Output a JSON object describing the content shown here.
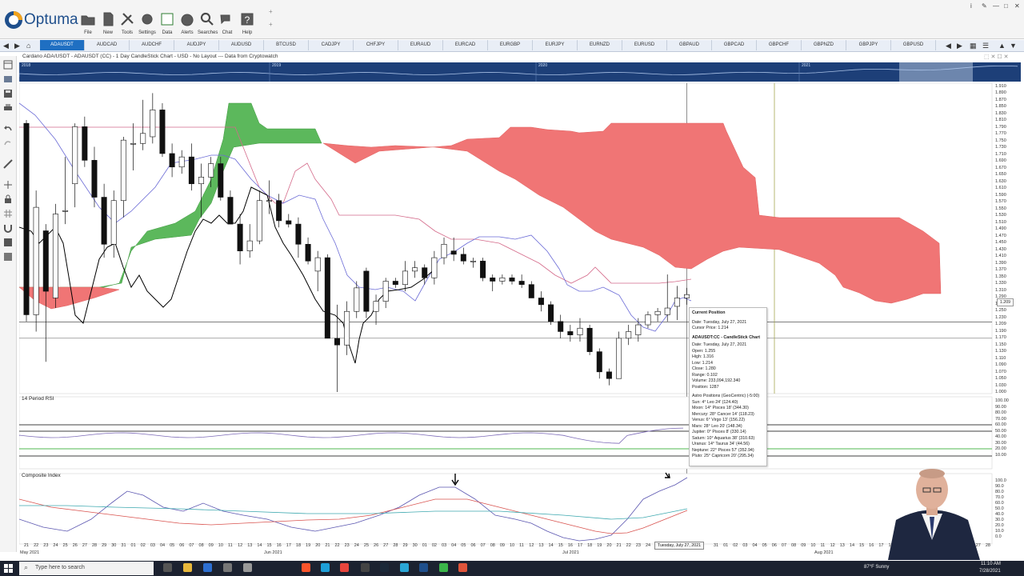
{
  "app": {
    "name": "Optuma",
    "toolbar": [
      {
        "label": "File",
        "icon": "folder-icon"
      },
      {
        "label": "New",
        "icon": "new-page-icon"
      },
      {
        "label": "Tools",
        "icon": "tools-icon"
      },
      {
        "label": "Settings",
        "icon": "gear-icon"
      },
      {
        "label": "Data",
        "icon": "binary-data-icon"
      },
      {
        "label": "Alerts",
        "icon": "alarm-clock-icon"
      },
      {
        "label": "Searches",
        "icon": "magnifier-icon"
      },
      {
        "label": "Chat",
        "icon": "chat-bubbles-icon"
      },
      {
        "label": "Help",
        "icon": "question-mark-icon"
      }
    ],
    "window_controls": {
      "info": "i",
      "pin": "✎",
      "minimize": "—",
      "maximize": "□",
      "close": "✕"
    }
  },
  "symbol_tabs": [
    "ADAUSDT",
    "AUDCAD",
    "AUDCHF",
    "AUDJPY",
    "AUDUSD",
    "BTCUSD",
    "CADJPY",
    "CHFJPY",
    "EURAUD",
    "EURCAD",
    "EURGBP",
    "EURJPY",
    "EURNZD",
    "EURUSD",
    "GBPAUD",
    "GBPCAD",
    "GBPCHF",
    "GBPNZD",
    "GBPJPY",
    "GBPUSD"
  ],
  "active_tab": "ADAUSDT",
  "chart_title": "Cardano ADA/USDT - ADAUSDT (CC) - 1 Day CandleStick Chart - USD - No Layout --- Data from Cryptowatch",
  "overview_years": [
    "2018",
    "2019",
    "2020",
    "2021"
  ],
  "panels": {
    "rsi_title": "14 Period RSI",
    "composite_title": "Composite Index"
  },
  "price_axis": [
    "1.910",
    "1.890",
    "1.870",
    "1.850",
    "1.830",
    "1.810",
    "1.790",
    "1.770",
    "1.750",
    "1.730",
    "1.710",
    "1.690",
    "1.670",
    "1.650",
    "1.630",
    "1.610",
    "1.590",
    "1.570",
    "1.550",
    "1.530",
    "1.510",
    "1.490",
    "1.470",
    "1.450",
    "1.430",
    "1.410",
    "1.390",
    "1.370",
    "1.350",
    "1.330",
    "1.310",
    "1.290",
    "1.270",
    "1.250",
    "1.230",
    "1.209",
    "1.190",
    "1.170",
    "1.150",
    "1.130",
    "1.110",
    "1.090",
    "1.070",
    "1.050",
    "1.030",
    "1.000"
  ],
  "rsi_axis": [
    "100.00",
    "90.00",
    "80.00",
    "70.00",
    "60.00",
    "50.00",
    "40.00",
    "30.00",
    "20.00",
    "10.00"
  ],
  "composite_axis": [
    "100.0",
    "90.0",
    "80.0",
    "70.0",
    "60.0",
    "50.0",
    "40.0",
    "30.0",
    "20.0",
    "10.0",
    "0.0"
  ],
  "date_axis": [
    "21",
    "22",
    "23",
    "24",
    "25",
    "26",
    "27",
    "28",
    "29",
    "30",
    "31",
    "01",
    "02",
    "03",
    "04",
    "05",
    "06",
    "07",
    "08",
    "09",
    "10",
    "11",
    "12",
    "13",
    "14",
    "15",
    "16",
    "17",
    "18",
    "19",
    "20",
    "21",
    "22",
    "23",
    "24",
    "25",
    "26",
    "27",
    "28",
    "29",
    "30",
    "01",
    "02",
    "03",
    "04",
    "05",
    "06",
    "07",
    "08",
    "09",
    "10",
    "11",
    "12",
    "13",
    "14",
    "15",
    "16",
    "17",
    "18",
    "19",
    "20",
    "21",
    "22",
    "23",
    "24",
    "25",
    "26",
    "27",
    "28",
    "29",
    "30",
    "31",
    "01",
    "02",
    "03",
    "04",
    "05",
    "06",
    "07",
    "08",
    "09",
    "10",
    "11",
    "12",
    "13",
    "14",
    "15",
    "16",
    "17",
    "18",
    "19",
    "20",
    "21",
    "22",
    "23",
    "24",
    "25",
    "26",
    "27",
    "28",
    "29",
    "30",
    "31",
    "01",
    "02",
    "03",
    "04",
    "05",
    "06",
    "07",
    "08",
    "09"
  ],
  "month_labels": [
    "May 2021",
    "Jun 2021",
    "Jul 2021",
    "Aug 2021"
  ],
  "cursor_date": "Tuesday, July 27, 2021",
  "price_tag": "1.209",
  "popup": {
    "section1_title": "Current Position",
    "section1": [
      "Date: Tuesday, July 27, 2021",
      "Cursor Price: 1.214"
    ],
    "section2_title": "ADAUSDT:CC - CandleStick Chart",
    "section2": [
      "Date: Tuesday, July 27, 2021",
      "Open: 1.255",
      "High: 1.316",
      "Low: 1.214",
      "Close: 1.280",
      "Range: 0.102",
      "Volume: 233,094,192.340",
      "Position: 1287"
    ],
    "section3_title": "Astro Positions (GeoCentric) (-5:00)",
    "section3": [
      "Sun: 4° Leo 24' (124.40)",
      "Moon: 14° Pisces 18' (344.30)",
      "Mercury: 28° Cancer 14' (118.23)",
      "Venus: 6° Virgo 13' (156.22)",
      "Mars: 28° Leo 20' (148.34)",
      "Jupiter: 0° Pisces 8' (330.14)",
      "Saturn: 10° Aquarius 38' (310.63)",
      "Uranus: 14° Taurus 34' (44.56)",
      "Neptune: 22° Pisces 57' (352.94)",
      "Pluto: 25° Capricorn 20' (295.34)"
    ]
  },
  "taskbar": {
    "search_placeholder": "Type here to search",
    "weather": "87°F Sunny",
    "time": "11:10 AM",
    "date": "7/28/2021"
  },
  "colors": {
    "kumo_bull": "#5cb85c",
    "kumo_bear": "#f07575",
    "tenkan": "#6b6bd6",
    "kijun": "#d46a8a",
    "chikou": "#000000",
    "accent": "#1f6fc2"
  },
  "chart_data": {
    "type": "candlestick",
    "instrument": "ADAUSDT",
    "timeframe": "1 Day",
    "ylim": [
      1.0,
      1.91
    ],
    "candles": [
      {
        "x": "May 21",
        "o": 1.8,
        "h": 1.81,
        "l": 1.21,
        "c": 1.23
      },
      {
        "x": "May 22",
        "o": 1.23,
        "h": 1.6,
        "l": 1.18,
        "c": 1.55
      },
      {
        "x": "May 23",
        "o": 1.48,
        "h": 1.5,
        "l": 1.09,
        "c": 1.3
      },
      {
        "x": "May 24",
        "o": 1.28,
        "h": 1.56,
        "l": 1.25,
        "c": 1.53
      },
      {
        "x": "May 25",
        "o": 1.54,
        "h": 1.7,
        "l": 1.5,
        "c": 1.54
      },
      {
        "x": "May 26",
        "o": 1.62,
        "h": 1.8,
        "l": 1.55,
        "c": 1.79
      },
      {
        "x": "May 27",
        "o": 1.79,
        "h": 1.82,
        "l": 1.67,
        "c": 1.69
      },
      {
        "x": "May 28",
        "o": 1.69,
        "h": 1.73,
        "l": 1.55,
        "c": 1.58
      },
      {
        "x": "May 29",
        "o": 1.58,
        "h": 1.62,
        "l": 1.4,
        "c": 1.44
      },
      {
        "x": "May 30",
        "o": 1.44,
        "h": 1.6,
        "l": 1.4,
        "c": 1.57
      },
      {
        "x": "May 31",
        "o": 1.57,
        "h": 1.76,
        "l": 1.52,
        "c": 1.75
      },
      {
        "x": "Jun 01",
        "o": 1.74,
        "h": 1.8,
        "l": 1.66,
        "c": 1.74
      },
      {
        "x": "Jun 02",
        "o": 1.74,
        "h": 1.87,
        "l": 1.72,
        "c": 1.77
      },
      {
        "x": "Jun 03",
        "o": 1.76,
        "h": 1.89,
        "l": 1.74,
        "c": 1.84
      },
      {
        "x": "Jun 04",
        "o": 1.84,
        "h": 1.86,
        "l": 1.7,
        "c": 1.71
      },
      {
        "x": "Jun 05",
        "o": 1.71,
        "h": 1.74,
        "l": 1.64,
        "c": 1.67
      },
      {
        "x": "Jun 06",
        "o": 1.67,
        "h": 1.72,
        "l": 1.65,
        "c": 1.7
      },
      {
        "x": "Jun 07",
        "o": 1.7,
        "h": 1.74,
        "l": 1.6,
        "c": 1.62
      },
      {
        "x": "Jun 08",
        "o": 1.62,
        "h": 1.68,
        "l": 1.52,
        "c": 1.64
      },
      {
        "x": "Jun 09",
        "o": 1.64,
        "h": 1.7,
        "l": 1.61,
        "c": 1.68
      },
      {
        "x": "Jun 10",
        "o": 1.68,
        "h": 1.7,
        "l": 1.57,
        "c": 1.58
      },
      {
        "x": "Jun 11",
        "o": 1.58,
        "h": 1.6,
        "l": 1.5,
        "c": 1.5
      },
      {
        "x": "Jun 12",
        "o": 1.5,
        "h": 1.53,
        "l": 1.38,
        "c": 1.42
      },
      {
        "x": "Jun 13",
        "o": 1.42,
        "h": 1.5,
        "l": 1.4,
        "c": 1.45
      },
      {
        "x": "Jun 14",
        "o": 1.45,
        "h": 1.6,
        "l": 1.44,
        "c": 1.57
      },
      {
        "x": "Jun 15",
        "o": 1.57,
        "h": 1.63,
        "l": 1.53,
        "c": 1.57
      },
      {
        "x": "Jun 16",
        "o": 1.57,
        "h": 1.59,
        "l": 1.49,
        "c": 1.51
      },
      {
        "x": "Jun 17",
        "o": 1.51,
        "h": 1.53,
        "l": 1.49,
        "c": 1.5
      },
      {
        "x": "Jun 18",
        "o": 1.5,
        "h": 1.52,
        "l": 1.4,
        "c": 1.44
      },
      {
        "x": "Jun 19",
        "o": 1.44,
        "h": 1.46,
        "l": 1.38,
        "c": 1.39
      },
      {
        "x": "Jun 20",
        "o": 1.36,
        "h": 1.42,
        "l": 1.3,
        "c": 1.4
      },
      {
        "x": "Jun 21",
        "o": 1.4,
        "h": 1.41,
        "l": 1.16,
        "c": 1.16
      },
      {
        "x": "Jun 22",
        "o": 1.16,
        "h": 1.26,
        "l": 1.0,
        "c": 1.14
      },
      {
        "x": "Jun 23",
        "o": 1.14,
        "h": 1.27,
        "l": 1.11,
        "c": 1.24
      },
      {
        "x": "Jun 24",
        "o": 1.24,
        "h": 1.33,
        "l": 1.22,
        "c": 1.31
      },
      {
        "x": "Jun 25",
        "o": 1.36,
        "h": 1.37,
        "l": 1.22,
        "c": 1.24
      },
      {
        "x": "Jun 26",
        "o": 1.24,
        "h": 1.29,
        "l": 1.2,
        "c": 1.27
      },
      {
        "x": "Jun 27",
        "o": 1.27,
        "h": 1.34,
        "l": 1.25,
        "c": 1.33
      },
      {
        "x": "Jun 28",
        "o": 1.33,
        "h": 1.34,
        "l": 1.31,
        "c": 1.32
      },
      {
        "x": "Jun 29",
        "o": 1.32,
        "h": 1.39,
        "l": 1.3,
        "c": 1.36
      },
      {
        "x": "Jun 30",
        "o": 1.36,
        "h": 1.39,
        "l": 1.34,
        "c": 1.37
      },
      {
        "x": "Jul 01",
        "o": 1.37,
        "h": 1.38,
        "l": 1.32,
        "c": 1.34
      },
      {
        "x": "Jul 02",
        "o": 1.34,
        "h": 1.42,
        "l": 1.32,
        "c": 1.4
      },
      {
        "x": "Jul 03",
        "o": 1.4,
        "h": 1.46,
        "l": 1.38,
        "c": 1.44
      },
      {
        "x": "Jul 04",
        "o": 1.42,
        "h": 1.46,
        "l": 1.39,
        "c": 1.41
      },
      {
        "x": "Jul 05",
        "o": 1.41,
        "h": 1.43,
        "l": 1.38,
        "c": 1.39
      },
      {
        "x": "Jul 06",
        "o": 1.39,
        "h": 1.4,
        "l": 1.37,
        "c": 1.39
      },
      {
        "x": "Jul 07",
        "o": 1.39,
        "h": 1.4,
        "l": 1.33,
        "c": 1.34
      },
      {
        "x": "Jul 08",
        "o": 1.34,
        "h": 1.35,
        "l": 1.3,
        "c": 1.33
      },
      {
        "x": "Jul 09",
        "o": 1.33,
        "h": 1.35,
        "l": 1.32,
        "c": 1.34
      },
      {
        "x": "Jul 10",
        "o": 1.34,
        "h": 1.35,
        "l": 1.32,
        "c": 1.33
      },
      {
        "x": "Jul 11",
        "o": 1.33,
        "h": 1.35,
        "l": 1.31,
        "c": 1.32
      },
      {
        "x": "Jul 12",
        "o": 1.32,
        "h": 1.33,
        "l": 1.28,
        "c": 1.28
      },
      {
        "x": "Jul 13",
        "o": 1.28,
        "h": 1.3,
        "l": 1.24,
        "c": 1.26
      },
      {
        "x": "Jul 14",
        "o": 1.26,
        "h": 1.27,
        "l": 1.2,
        "c": 1.21
      },
      {
        "x": "Jul 15",
        "o": 1.21,
        "h": 1.23,
        "l": 1.16,
        "c": 1.18
      },
      {
        "x": "Jul 16",
        "o": 1.18,
        "h": 1.2,
        "l": 1.15,
        "c": 1.17
      },
      {
        "x": "Jul 17",
        "o": 1.17,
        "h": 1.22,
        "l": 1.15,
        "c": 1.19
      },
      {
        "x": "Jul 18",
        "o": 1.19,
        "h": 1.2,
        "l": 1.11,
        "c": 1.12
      },
      {
        "x": "Jul 19",
        "o": 1.12,
        "h": 1.13,
        "l": 1.04,
        "c": 1.06
      },
      {
        "x": "Jul 20",
        "o": 1.06,
        "h": 1.07,
        "l": 1.02,
        "c": 1.04
      },
      {
        "x": "Jul 21",
        "o": 1.04,
        "h": 1.18,
        "l": 1.04,
        "c": 1.16
      },
      {
        "x": "Jul 22",
        "o": 1.16,
        "h": 1.2,
        "l": 1.14,
        "c": 1.18
      },
      {
        "x": "Jul 23",
        "o": 1.17,
        "h": 1.22,
        "l": 1.15,
        "c": 1.2
      },
      {
        "x": "Jul 24",
        "o": 1.2,
        "h": 1.24,
        "l": 1.19,
        "c": 1.23
      },
      {
        "x": "Jul 25",
        "o": 1.23,
        "h": 1.25,
        "l": 1.21,
        "c": 1.24
      },
      {
        "x": "Jul 26",
        "o": 1.23,
        "h": 1.35,
        "l": 1.21,
        "c": 1.25
      },
      {
        "x": "Jul 27",
        "o": 1.255,
        "h": 1.316,
        "l": 1.214,
        "c": 1.28
      },
      {
        "x": "Jul 28",
        "o": 1.28,
        "h": 1.31,
        "l": 1.26,
        "c": 1.29
      }
    ]
  }
}
